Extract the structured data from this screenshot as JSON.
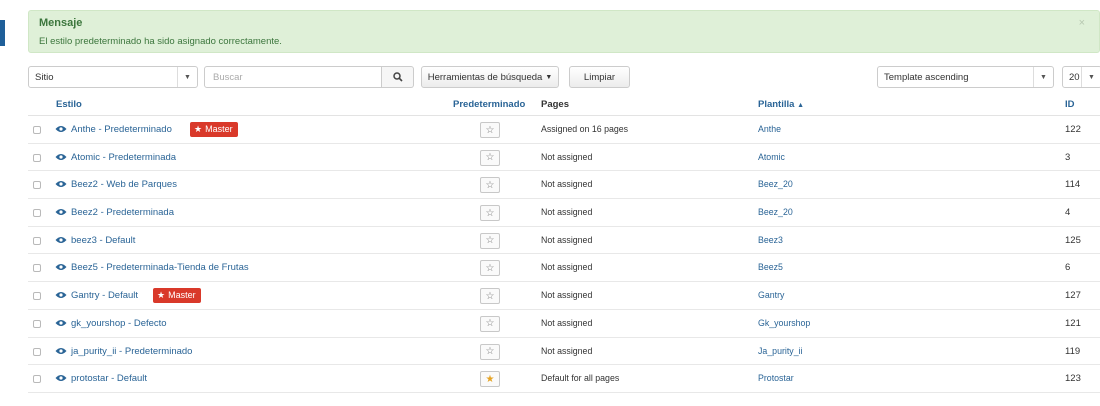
{
  "alert": {
    "title": "Mensaje",
    "text": "El estilo predeterminado ha sido asignado correctamente.",
    "close": "×"
  },
  "toolbar": {
    "client_select": "Sitio",
    "search_placeholder": "Buscar",
    "search_tools_label": "Herramientas de búsqueda",
    "clear_label": "Limpiar",
    "ordering_select": "Template ascending",
    "limit_select": "20"
  },
  "columns": {
    "style": "Estilo",
    "default": "Predeterminado",
    "pages": "Pages",
    "template": "Plantilla",
    "template_sort": "▲",
    "id": "ID"
  },
  "rows": [
    {
      "name": "Anthe - Predeterminado",
      "master": "Master",
      "pages": "Assigned on 16 pages",
      "template": "Anthe",
      "id": "122",
      "is_default": false
    },
    {
      "name": "Atomic - Predeterminada",
      "pages": "Not assigned",
      "template": "Atomic",
      "id": "3",
      "is_default": false
    },
    {
      "name": "Beez2 - Web de Parques",
      "pages": "Not assigned",
      "template": "Beez_20",
      "id": "114",
      "is_default": false
    },
    {
      "name": "Beez2 - Predeterminada",
      "pages": "Not assigned",
      "template": "Beez_20",
      "id": "4",
      "is_default": false
    },
    {
      "name": "beez3 - Default",
      "pages": "Not assigned",
      "template": "Beez3",
      "id": "125",
      "is_default": false
    },
    {
      "name": "Beez5 - Predeterminada-Tienda de Frutas",
      "pages": "Not assigned",
      "template": "Beez5",
      "id": "6",
      "is_default": false
    },
    {
      "name": "Gantry - Default",
      "master": "Master",
      "pages": "Not assigned",
      "template": "Gantry",
      "id": "127",
      "is_default": false
    },
    {
      "name": "gk_yourshop - Defecto",
      "pages": "Not assigned",
      "template": "Gk_yourshop",
      "id": "121",
      "is_default": false
    },
    {
      "name": "ja_purity_ii - Predeterminado",
      "pages": "Not assigned",
      "template": "Ja_purity_ii",
      "id": "119",
      "is_default": false
    },
    {
      "name": "protostar - Default",
      "pages": "Default for all pages",
      "template": "Protostar",
      "id": "123",
      "is_default": true
    }
  ],
  "icons": {
    "star": "☆",
    "star_filled": "★",
    "caret": "▼"
  },
  "colors": {
    "link": "#2a6496",
    "alert_bg": "#dff0d8",
    "alert_text": "#3c763d",
    "master_badge": "#d9392a",
    "default_star": "#e5a324"
  }
}
